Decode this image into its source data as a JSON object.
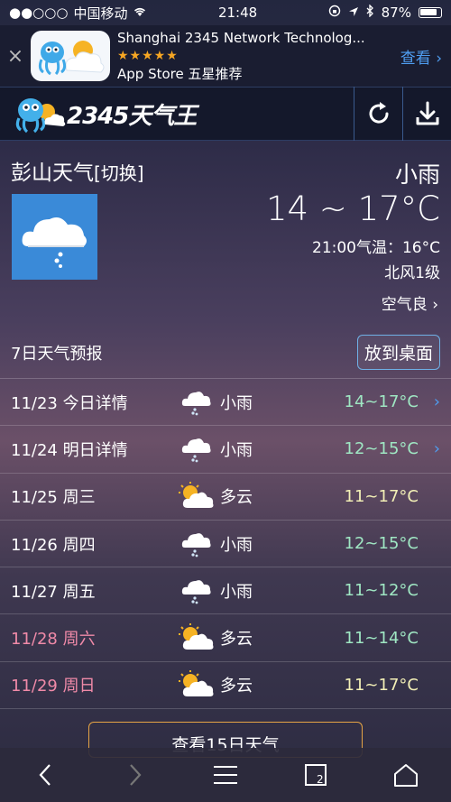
{
  "status_bar": {
    "signal": "●●○○○",
    "carrier": "中国移动",
    "time": "21:48",
    "battery": "87%"
  },
  "ad": {
    "close": "×",
    "title": "Shanghai 2345 Network Technolog...",
    "stars": "★★★★★",
    "subtitle": "App Store 五星推荐",
    "view_label": "查看 ›"
  },
  "header": {
    "logo_text": "2345天气王",
    "refresh_icon": "refresh-icon",
    "download_icon": "download-icon"
  },
  "current": {
    "city": "彭山天气",
    "switch_label": "[切换]",
    "condition": "小雨",
    "temp_range": "14 ~ 17°C",
    "hourly_temp": "21:00气温：16°C",
    "wind": "北风1级",
    "air_quality": "空气良 ›"
  },
  "forecast": {
    "title": "7日天气预报",
    "desktop_button": "放到桌面",
    "days": [
      {
        "date": "11/23  今日详情",
        "icon": "rain",
        "condition": "小雨",
        "temp": "14~17°C",
        "arrow": "›"
      },
      {
        "date": "11/24  明日详情",
        "icon": "rain",
        "condition": "小雨",
        "temp": "12~15°C",
        "arrow": "›"
      },
      {
        "date": "11/25 周三",
        "icon": "cloudy",
        "condition": "多云",
        "temp": "11~17°C",
        "arrow": ""
      },
      {
        "date": "11/26 周四",
        "icon": "rain",
        "condition": "小雨",
        "temp": "12~15°C",
        "arrow": ""
      },
      {
        "date": "11/27 周五",
        "icon": "rain",
        "condition": "小雨",
        "temp": "11~12°C",
        "arrow": ""
      },
      {
        "date": "11/28 周六",
        "icon": "cloudy",
        "condition": "多云",
        "temp": "11~14°C",
        "arrow": ""
      },
      {
        "date": "11/29 周日",
        "icon": "cloudy",
        "condition": "多云",
        "temp": "11~17°C",
        "arrow": ""
      }
    ],
    "more_button": "查看15日天气"
  },
  "bottom_bar": {
    "tab_count": "2"
  }
}
